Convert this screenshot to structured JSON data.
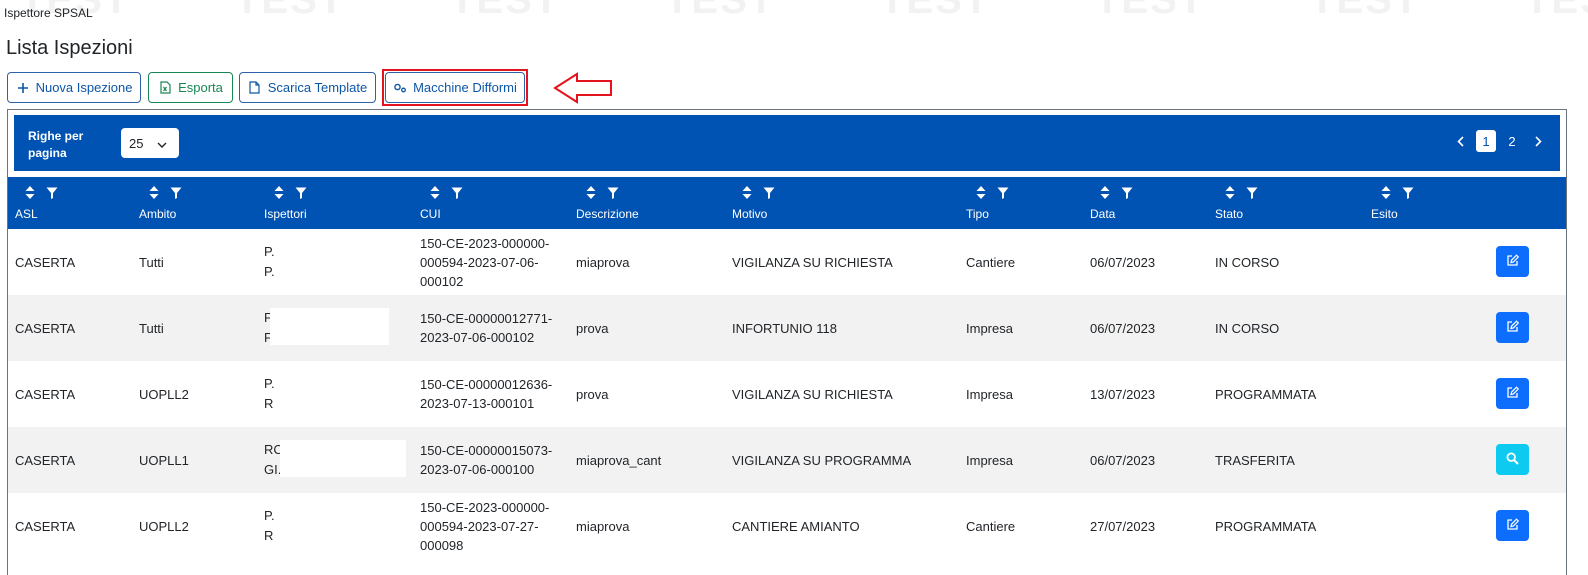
{
  "watermark": {
    "text": "TEST"
  },
  "app": {
    "title": "Ispettore SPSAL"
  },
  "page": {
    "title": "Lista Ispezioni"
  },
  "toolbar": {
    "new_label": "Nuova Ispezione",
    "export_label": "Esporta",
    "template_label": "Scarica Template",
    "machines_label": "Macchine Difformi"
  },
  "pager": {
    "rows_label": "Righe per pagina",
    "rows_value": "25",
    "pages": [
      "1",
      "2"
    ],
    "active_page": "1"
  },
  "columns": [
    "ASL",
    "Ambito",
    "Ispettori",
    "CUI",
    "Descrizione",
    "Motivo",
    "Tipo",
    "Data",
    "Stato",
    "Esito"
  ],
  "rows": [
    {
      "asl": "CASERTA",
      "ambito": "Tutti",
      "insp1": "P.",
      "insp2": "P.",
      "cui": "150-CE-2023-000000-000594-2023-07-06-000102",
      "descrizione": "miaprova",
      "motivo": "VIGILANZA SU RICHIESTA",
      "tipo": "Cantiere",
      "data": "06/07/2023",
      "stato": "IN CORSO",
      "esito": "",
      "action_icon": "edit-icon"
    },
    {
      "asl": "CASERTA",
      "ambito": "Tutti",
      "insp1": "F",
      "insp2": "F",
      "cui": "150-CE-00000012771-2023-07-06-000102",
      "descrizione": "prova",
      "motivo": "INFORTUNIO 118",
      "tipo": "Impresa",
      "data": "06/07/2023",
      "stato": "IN CORSO",
      "esito": "",
      "action_icon": "edit-icon"
    },
    {
      "asl": "CASERTA",
      "ambito": "UOPLL2",
      "insp1": "P.",
      "insp2": "R",
      "cui": "150-CE-00000012636-2023-07-13-000101",
      "descrizione": "prova",
      "motivo": "VIGILANZA SU RICHIESTA",
      "tipo": "Impresa",
      "data": "13/07/2023",
      "stato": "PROGRAMMATA",
      "esito": "",
      "action_icon": "edit-icon"
    },
    {
      "asl": "CASERTA",
      "ambito": "UOPLL1",
      "insp1": "RC",
      "insp2": "GI.",
      "cui": "150-CE-00000015073-2023-07-06-000100",
      "descrizione": "miaprova_cant",
      "motivo": "VIGILANZA SU PROGRAMMA",
      "tipo": "Impresa",
      "data": "06/07/2023",
      "stato": "TRASFERITA",
      "esito": "",
      "action_icon": "search-icon"
    },
    {
      "asl": "CASERTA",
      "ambito": "UOPLL2",
      "insp1": "P.",
      "insp2": "R",
      "cui": "150-CE-2023-000000-000594-2023-07-27-000098",
      "descrizione": "miaprova",
      "motivo": "CANTIERE AMIANTO",
      "tipo": "Cantiere",
      "data": "27/07/2023",
      "stato": "PROGRAMMATA",
      "esito": "",
      "action_icon": "edit-icon"
    }
  ],
  "colors": {
    "header_blue": "#0053b3",
    "primary": "#0d6efd",
    "info": "#0dcaf0",
    "success": "#198754",
    "highlight": "#e3141e"
  }
}
